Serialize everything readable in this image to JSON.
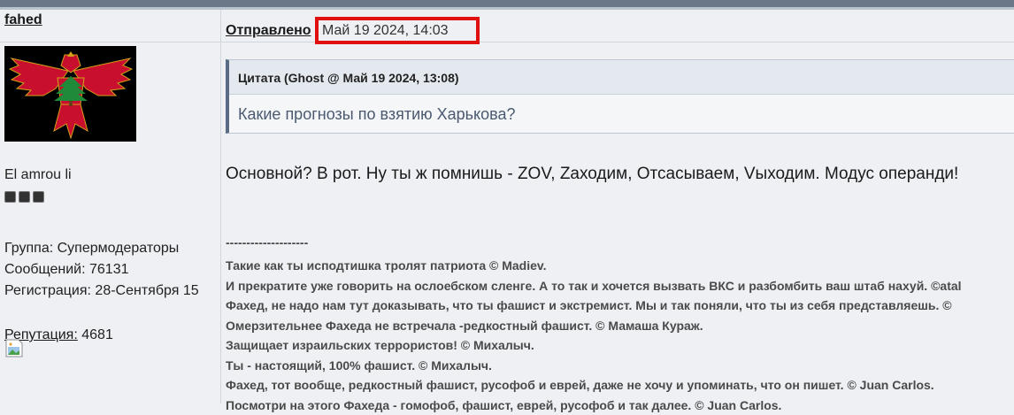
{
  "user": {
    "name": "fahed",
    "title": "El amrou li",
    "group": "Группа: Супермодераторы",
    "posts": "Сообщений: 76131",
    "registered": "Регистрация: 28-Сентября 15",
    "reputation_label": "Репутация:",
    "reputation_value": "4681",
    "rank_pips": 3
  },
  "post": {
    "posted_label": "Отправлено",
    "date": "Май 19 2024, 14:03",
    "quote_author": "Цитата (Ghost @ Май 19 2024, 13:08)",
    "quote_text": "Какие прогнозы по взятию Харькова?",
    "body": "Основной? В рот. Ну ты ж помнишь - ZOV, Zаходим, Oтсасываем, Vыходим. Модус операнди!"
  },
  "signature": {
    "separator": "--------------------",
    "lines": [
      "Такие как ты исподтишка тролят патриота © Madiev.",
      "И прекратите уже говорить на ослоебском сленге. А то так и хочется вызвать ВКС и разбомбить ваш штаб нахуй. ©atal",
      "Фахед, не надо нам тут доказывать, что ты фашист и экстремист. Мы и так поняли, что ты из себя представляешь. ©",
      "Омерзительнее Фахеда не встречала -редкостный фашист. © Мамаша Кураж.",
      "Защищает израильских террористов! © Михалыч.",
      "Ты - настоящий, 100% фашист. © Михалыч.",
      "Фахед, тот вообще, редкостный фашист, русофоб и еврей, даже не хочу и упоминать, что он пишет. © Juan Carlos.",
      "Посмотри на этого Фахеда - гомофоб, фашист, еврей, русофоб и так далее. © Juan Carlos."
    ]
  },
  "colors": {
    "highlight": "#e01010",
    "quote_border": "#5a6b85",
    "top_bar": "#6a7887"
  }
}
